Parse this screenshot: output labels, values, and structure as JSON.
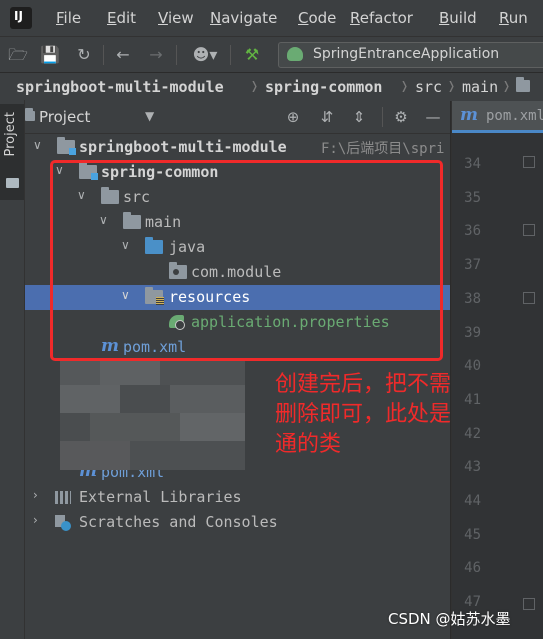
{
  "menu": [
    "File",
    "Edit",
    "View",
    "Navigate",
    "Code",
    "Refactor",
    "Build",
    "Run"
  ],
  "toolbar": {
    "icons": [
      "open-folder-icon",
      "save-icon",
      "sync-icon",
      "back-arrow-icon",
      "forward-arrow-icon",
      "vcs-user-icon",
      "build-hammer-icon"
    ],
    "run_config": "SpringEntranceApplication"
  },
  "breadcrumb": [
    "springboot-multi-module",
    "spring-common",
    "src",
    "main"
  ],
  "side_tab": "Project",
  "panel": {
    "title": "Project",
    "icons": [
      "locate-icon",
      "collapse-all-icon",
      "expand-all-icon",
      "settings-gear-icon",
      "hide-panel-icon"
    ]
  },
  "tree": {
    "root_label": "springboot-multi-module",
    "root_path": "F:\\后端项目\\spri",
    "module": "spring-common",
    "src": "src",
    "main": "main",
    "java": "java",
    "package": "com.module",
    "resources": "resources",
    "properties_file": "application.properties",
    "module_pom": "pom.xml",
    "root_pom": "pom.xml",
    "external_libraries": "External Libraries",
    "scratches": "Scratches and Consoles"
  },
  "annotation": {
    "line1": "创建完后，把不需要的",
    "line2": "删除即可，此处是放共",
    "line3": "通的类"
  },
  "editor": {
    "tab_label": "pom.xml",
    "tab_icon": "m",
    "line_numbers": [
      "34",
      "35",
      "36",
      "37",
      "38",
      "39",
      "40",
      "41",
      "42",
      "43",
      "44",
      "45",
      "46",
      "47"
    ]
  },
  "watermark": "CSDN @姑苏水墨",
  "colors": {
    "selection": "#4b6eaf",
    "annotation_red": "#f02a2a",
    "resource_text": "#6aab73",
    "pom_blue": "#5c91d6"
  }
}
